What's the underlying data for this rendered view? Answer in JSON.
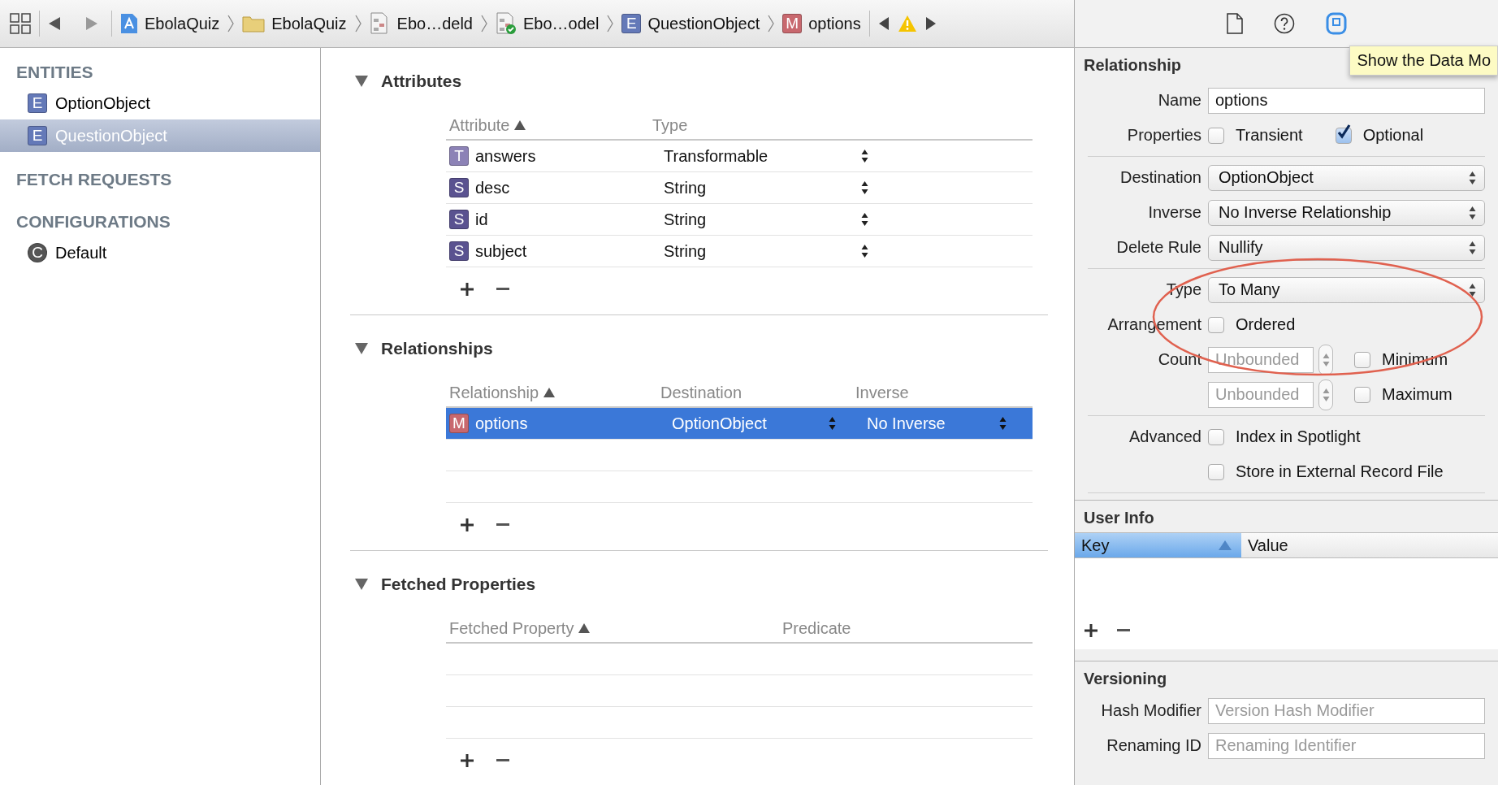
{
  "jump_bar": {
    "items": [
      {
        "kind": "project",
        "label": "EbolaQuiz"
      },
      {
        "kind": "folder",
        "label": "EbolaQuiz"
      },
      {
        "kind": "model",
        "label": "Ebo…deld"
      },
      {
        "kind": "model-version",
        "label": "Ebo…odel"
      },
      {
        "kind": "entity",
        "badge": "E",
        "label": "QuestionObject"
      },
      {
        "kind": "relationship",
        "badge": "M",
        "label": "options"
      }
    ]
  },
  "sidebar": {
    "sections": [
      {
        "title": "ENTITIES",
        "items": [
          {
            "kind": "entity",
            "badge": "E",
            "label": "OptionObject",
            "selected": false
          },
          {
            "kind": "entity",
            "badge": "E",
            "label": "QuestionObject",
            "selected": true
          }
        ]
      },
      {
        "title": "FETCH REQUESTS"
      },
      {
        "title": "CONFIGURATIONS",
        "items": [
          {
            "kind": "configuration",
            "badge": "C",
            "label": "Default",
            "selected": false
          }
        ]
      }
    ]
  },
  "editor": {
    "sections": [
      {
        "title": "Attributes",
        "expanded": true,
        "columns": [
          {
            "label": "Attribute",
            "sorted": true
          },
          {
            "label": "Type",
            "sorted": false
          }
        ],
        "rows": [
          {
            "badge": "T",
            "color": "#8c82b6",
            "cells": [
              "answers",
              "Transformable"
            ],
            "selected": false
          },
          {
            "badge": "S",
            "color": "#5a5290",
            "cells": [
              "desc",
              "String"
            ],
            "selected": false
          },
          {
            "badge": "S",
            "color": "#5a5290",
            "cells": [
              "id",
              "String"
            ],
            "selected": false
          },
          {
            "badge": "S",
            "color": "#5a5290",
            "cells": [
              "subject",
              "String"
            ],
            "selected": false
          }
        ]
      },
      {
        "title": "Relationships",
        "expanded": true,
        "columns": [
          {
            "label": "Relationship",
            "sorted": true
          },
          {
            "label": "Destination",
            "sorted": false
          },
          {
            "label": "Inverse",
            "sorted": false
          }
        ],
        "rows": [
          {
            "badge": "M",
            "color": "#c8686e",
            "cells": [
              "options",
              "OptionObject",
              "No Inverse"
            ],
            "selected": true
          }
        ]
      },
      {
        "title": "Fetched Properties",
        "expanded": true,
        "columns": [
          {
            "label": "Fetched Property",
            "sorted": true
          },
          {
            "label": "Predicate",
            "sorted": false
          }
        ]
      }
    ]
  },
  "inspector": {
    "tabs": [
      {
        "kind": "file",
        "selected": false
      },
      {
        "kind": "help",
        "selected": false
      },
      {
        "kind": "data-model",
        "selected": true
      }
    ],
    "tooltip": "Show the Data Mo",
    "relationship": {
      "title": "Relationship",
      "groups": [
        [
          {
            "kind": "field",
            "label": "Name",
            "value": "options"
          },
          {
            "kind": "checks",
            "label": "Properties",
            "options": [
              {
                "label": "Transient",
                "checked": false
              },
              {
                "label": "Optional",
                "checked": true
              }
            ]
          }
        ],
        [
          {
            "kind": "popup",
            "label": "Destination",
            "value": "OptionObject"
          },
          {
            "kind": "popup",
            "label": "Inverse",
            "value": "No Inverse Relationship"
          },
          {
            "kind": "popup",
            "label": "Delete Rule",
            "value": "Nullify"
          }
        ],
        [
          {
            "kind": "popup",
            "label": "Type",
            "value": "To Many"
          },
          {
            "kind": "checks",
            "label": "Arrangement",
            "options": [
              {
                "label": "Ordered",
                "checked": false
              }
            ]
          },
          {
            "kind": "count",
            "label": "Count",
            "placeholder": "Unbounded",
            "option": {
              "label": "Minimum",
              "checked": false
            }
          },
          {
            "kind": "count",
            "placeholder": "Unbounded",
            "option": {
              "label": "Maximum",
              "checked": false
            }
          }
        ],
        [
          {
            "kind": "checks",
            "label": "Advanced",
            "options": [
              {
                "label": "Index in Spotlight",
                "checked": false
              }
            ]
          },
          {
            "kind": "checks",
            "options": [
              {
                "label": "Store in External Record File",
                "checked": false
              }
            ]
          }
        ]
      ]
    },
    "user_info": {
      "title": "User Info",
      "columns": [
        {
          "label": "Key",
          "sorted": true,
          "selected": true
        },
        {
          "label": "Value",
          "sorted": false,
          "selected": false
        }
      ]
    },
    "versioning": {
      "title": "Versioning",
      "rows": [
        {
          "kind": "field",
          "label": "Hash Modifier",
          "placeholder": "Version Hash Modifier"
        },
        {
          "kind": "field",
          "label": "Renaming ID",
          "placeholder": "Renaming Identifier"
        }
      ]
    }
  }
}
